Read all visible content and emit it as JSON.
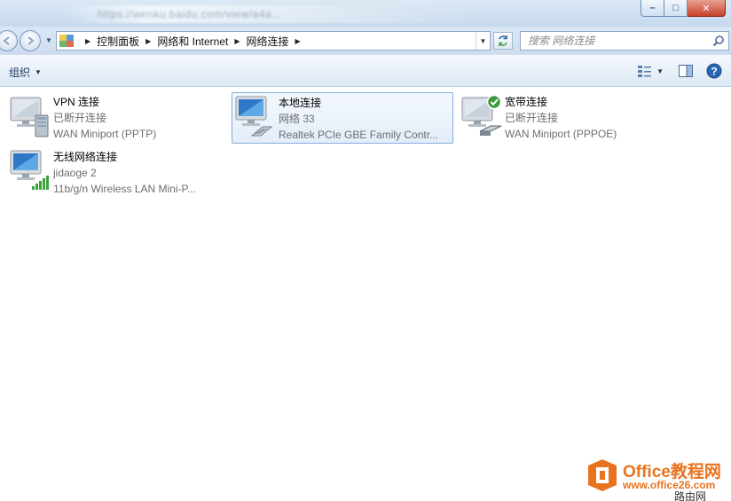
{
  "window": {
    "blurred_title": "https://wenku.baidu.com/view/a4a...",
    "minimize_label": "–",
    "maximize_label": "□",
    "close_label": "✕"
  },
  "addressbar": {
    "breadcrumbs": [
      "控制面板",
      "网络和 Internet",
      "网络连接"
    ],
    "search_placeholder": "搜索 网络连接"
  },
  "toolbar": {
    "organize_label": "组织"
  },
  "connections": [
    {
      "name": "VPN 连接",
      "status": "已断开连接",
      "device": "WAN Miniport (PPTP)",
      "selected": false,
      "icon": "vpn-connection-icon"
    },
    {
      "name": "本地连接",
      "status": "网络  33",
      "device": "Realtek PCIe GBE Family Contr...",
      "selected": true,
      "icon": "local-area-connection-icon"
    },
    {
      "name": "宽带连接",
      "status": "已断开连接",
      "device": "WAN Miniport (PPPOE)",
      "selected": false,
      "icon": "broadband-connection-icon"
    },
    {
      "name": "无线网络连接",
      "status": "jidaoge  2",
      "device": "11b/g/n  Wireless LAN Mini-P...",
      "selected": false,
      "icon": "wireless-connection-icon"
    }
  ],
  "watermark": {
    "title": "Office教程网",
    "url": "www.office26.com",
    "tag": "路由网"
  },
  "colors": {
    "selection_border": "#84acdd",
    "watermark_orange": "#e8731f"
  }
}
